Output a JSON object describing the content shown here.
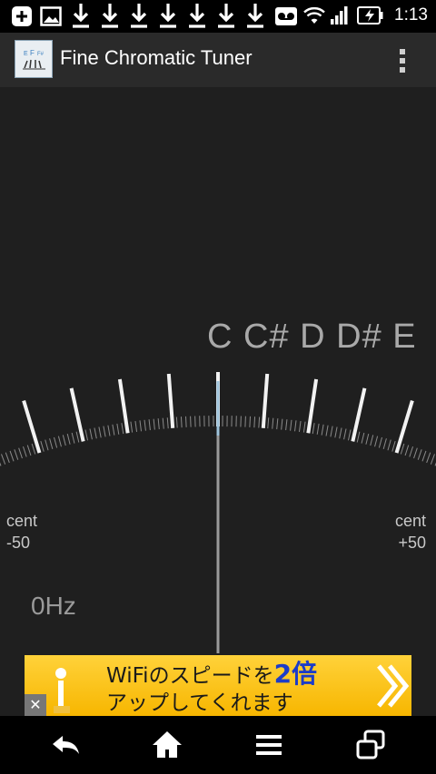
{
  "status_bar": {
    "time": "1:13",
    "icons": [
      "add-icon",
      "image-icon",
      "download-icon",
      "download-icon",
      "download-icon",
      "download-icon",
      "download-icon",
      "download-icon",
      "download-icon",
      "voicemail-icon",
      "wifi-icon",
      "signal-icon",
      "battery-charging-icon"
    ]
  },
  "action_bar": {
    "title": "Fine Chromatic Tuner",
    "app_icon_text": "E F F#"
  },
  "tuner": {
    "notes_text": "C C# D D# E",
    "left_cent_unit": "cent",
    "left_cent_value": "-50",
    "right_cent_unit": "cent",
    "right_cent_value": "+50",
    "frequency": "0Hz",
    "needle_cents": 0
  },
  "ad": {
    "line1_a": "WiFiのスピードを",
    "line1_b": "2倍",
    "line2": "アップしてくれます",
    "close": "✕"
  },
  "nav_bar": {
    "buttons": [
      "back-icon",
      "home-icon",
      "menu-icon",
      "recent-apps-icon"
    ]
  }
}
